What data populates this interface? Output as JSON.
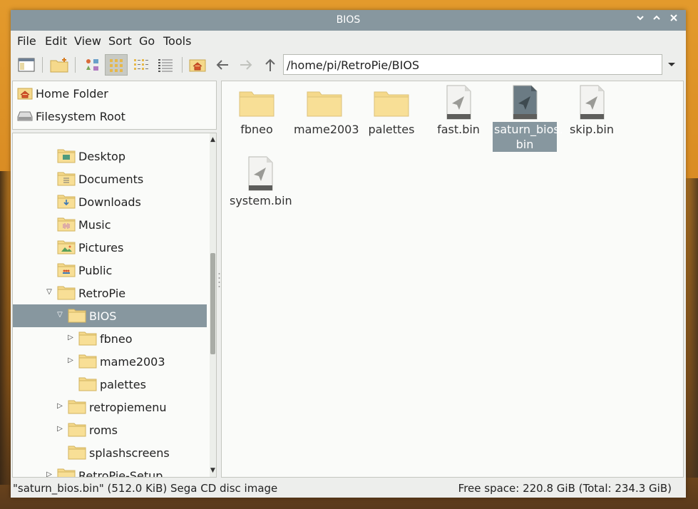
{
  "window": {
    "title": "BIOS"
  },
  "menu": [
    "File",
    "Edit",
    "View",
    "Sort",
    "Go",
    "Tools"
  ],
  "toolbar": {
    "path": "/home/pi/RetroPie/BIOS",
    "icons": [
      "new-window-icon",
      "new-folder-icon",
      "icon-view-icon",
      "thumbnail-view-icon",
      "compact-view-icon",
      "detailed-list-icon",
      "home-icon",
      "back-arrow-icon",
      "forward-arrow-icon",
      "up-arrow-icon"
    ]
  },
  "places": [
    {
      "label": "Home Folder",
      "icon": "home-folder-icon"
    },
    {
      "label": "Filesystem Root",
      "icon": "drive-icon"
    }
  ],
  "tree": [
    {
      "label": "Desktop",
      "level": 2,
      "expander": "",
      "icon": "desktop-folder-icon"
    },
    {
      "label": "Documents",
      "level": 2,
      "expander": "",
      "icon": "documents-folder-icon"
    },
    {
      "label": "Downloads",
      "level": 2,
      "expander": "",
      "icon": "downloads-folder-icon"
    },
    {
      "label": "Music",
      "level": 2,
      "expander": "",
      "icon": "music-folder-icon"
    },
    {
      "label": "Pictures",
      "level": 2,
      "expander": "",
      "icon": "pictures-folder-icon"
    },
    {
      "label": "Public",
      "level": 2,
      "expander": "",
      "icon": "public-folder-icon"
    },
    {
      "label": "RetroPie",
      "level": 2,
      "expander": "open",
      "icon": "folder-icon"
    },
    {
      "label": "BIOS",
      "level": 3,
      "expander": "open",
      "icon": "folder-icon",
      "selected": true
    },
    {
      "label": "fbneo",
      "level": 4,
      "expander": "closed",
      "icon": "folder-icon"
    },
    {
      "label": "mame2003",
      "level": 4,
      "expander": "closed",
      "icon": "folder-icon"
    },
    {
      "label": "palettes",
      "level": 4,
      "expander": "",
      "icon": "folder-icon"
    },
    {
      "label": "retropiemenu",
      "level": 3,
      "expander": "closed",
      "icon": "folder-icon"
    },
    {
      "label": "roms",
      "level": 3,
      "expander": "closed",
      "icon": "folder-icon"
    },
    {
      "label": "splashscreens",
      "level": 3,
      "expander": "",
      "icon": "folder-icon"
    },
    {
      "label": "RetroPie-Setup",
      "level": 2,
      "expander": "closed",
      "icon": "folder-icon"
    }
  ],
  "files": [
    {
      "name": "fbneo",
      "type": "folder"
    },
    {
      "name": "mame2003",
      "type": "folder"
    },
    {
      "name": "palettes",
      "type": "folder"
    },
    {
      "name": "fast.bin",
      "type": "file"
    },
    {
      "name": "saturn_bios.bin",
      "name_lines": [
        "saturn_bios.",
        "bin"
      ],
      "type": "file",
      "selected": true
    },
    {
      "name": "skip.bin",
      "type": "file"
    },
    {
      "name": "system.bin",
      "type": "file"
    }
  ],
  "status": {
    "left": "\"saturn_bios.bin\" (512.0 KiB) Sega CD disc image",
    "right": "Free space: 220.8 GiB (Total: 234.3 GiB)"
  },
  "colors": {
    "selection": "#87979f",
    "folder": "#f5d98b",
    "titlebar": "#87979f"
  }
}
